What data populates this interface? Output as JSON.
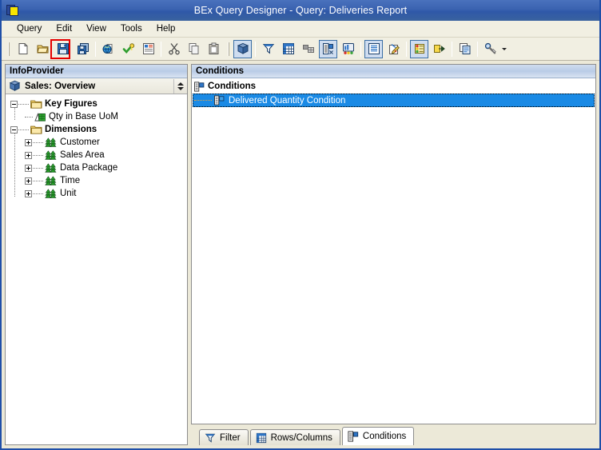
{
  "window": {
    "title": "BEx Query Designer - Query: Deliveries Report",
    "app_icon": "bex-app-icon"
  },
  "menubar": {
    "items": [
      {
        "label": "Query",
        "name": "menu-query"
      },
      {
        "label": "Edit",
        "name": "menu-edit"
      },
      {
        "label": "View",
        "name": "menu-view"
      },
      {
        "label": "Tools",
        "name": "menu-tools"
      },
      {
        "label": "Help",
        "name": "menu-help"
      }
    ]
  },
  "toolbar": {
    "buttons": [
      {
        "name": "new-query-button",
        "icon": "new-document-icon",
        "tooltip": "New Query",
        "active": false
      },
      {
        "name": "open-query-button",
        "icon": "open-folder-icon",
        "tooltip": "Open Query",
        "active": false
      },
      {
        "name": "save-query-button",
        "icon": "save-floppy-icon",
        "tooltip": "Save Query",
        "active": false,
        "highlighted": true
      },
      {
        "name": "save-as-button",
        "icon": "save-as-icon",
        "tooltip": "Save Query As",
        "active": false
      },
      {
        "name": "publish-button",
        "icon": "globe-icon",
        "tooltip": "Publish",
        "active": false
      },
      {
        "name": "check-query-button",
        "icon": "check-key-icon",
        "tooltip": "Check Query",
        "active": false
      },
      {
        "name": "query-properties-button",
        "icon": "query-properties-icon",
        "tooltip": "Query Properties",
        "active": false
      },
      {
        "name": "cut-button",
        "icon": "scissors-icon",
        "tooltip": "Cut",
        "active": false
      },
      {
        "name": "copy-button",
        "icon": "copy-icon",
        "tooltip": "Copy",
        "active": false
      },
      {
        "name": "paste-button",
        "icon": "paste-icon",
        "tooltip": "Paste",
        "active": false
      },
      {
        "name": "infoprovider-button",
        "icon": "cube-icon",
        "tooltip": "InfoProvider",
        "active": true
      },
      {
        "name": "filter-toggle-button",
        "icon": "funnel-icon",
        "tooltip": "Filter",
        "active": false
      },
      {
        "name": "rows-columns-button",
        "icon": "grid-icon",
        "tooltip": "Rows/Columns",
        "active": false
      },
      {
        "name": "cell-definition-button",
        "icon": "cells-icon",
        "tooltip": "Cells",
        "active": false
      },
      {
        "name": "conditions-toggle-button",
        "icon": "conditions-icon",
        "tooltip": "Conditions",
        "active": true
      },
      {
        "name": "chart-preview-button",
        "icon": "chart-monitor-icon",
        "tooltip": "Chart",
        "active": false
      },
      {
        "name": "exceptions-list-button",
        "icon": "exceptions-list-icon",
        "tooltip": "Exceptions",
        "active": true
      },
      {
        "name": "document-properties-button",
        "icon": "doc-pencil-icon",
        "tooltip": "Documents",
        "active": false
      },
      {
        "name": "condition-define-button",
        "icon": "condition-stack-icon",
        "tooltip": "Define Condition",
        "active": true
      },
      {
        "name": "jump-target-button",
        "icon": "jump-arrow-icon",
        "tooltip": "Jump Targets",
        "active": false
      },
      {
        "name": "variables-button",
        "icon": "variables-icon",
        "tooltip": "Variables",
        "active": false
      },
      {
        "name": "settings-button",
        "icon": "wrench-icon",
        "tooltip": "Settings",
        "active": false
      }
    ]
  },
  "infoprovider": {
    "panel_title": "InfoProvider",
    "provider_name": "Sales: Overview",
    "provider_icon": "cube-icon",
    "spinner_name": "provider-spinner",
    "tree": [
      {
        "label": "Key Figures",
        "icon": "folder-icon",
        "bold": true,
        "expander": "minus",
        "name": "tree-node-key-figures",
        "children": [
          {
            "label": "Qty in Base UoM",
            "icon": "key-figure-icon",
            "bold": false,
            "name": "tree-node-qty-in-base-uom"
          }
        ]
      },
      {
        "label": "Dimensions",
        "icon": "folder-icon",
        "bold": true,
        "expander": "minus",
        "name": "tree-node-dimensions",
        "children": [
          {
            "label": "Customer",
            "icon": "dimension-icon",
            "bold": false,
            "expander": "plus",
            "name": "tree-node-customer"
          },
          {
            "label": "Sales Area",
            "icon": "dimension-icon",
            "bold": false,
            "expander": "plus",
            "name": "tree-node-sales-area"
          },
          {
            "label": "Data Package",
            "icon": "dimension-icon",
            "bold": false,
            "expander": "plus",
            "name": "tree-node-data-package"
          },
          {
            "label": "Time",
            "icon": "dimension-icon",
            "bold": false,
            "expander": "plus",
            "name": "tree-node-time"
          },
          {
            "label": "Unit",
            "icon": "dimension-icon",
            "bold": false,
            "expander": "plus",
            "name": "tree-node-unit"
          }
        ]
      }
    ]
  },
  "conditions": {
    "panel_title": "Conditions",
    "root_label": "Conditions",
    "root_icon": "conditions-icon",
    "items": [
      {
        "label": "Delivered Quantity Condition",
        "icon": "condition-item-icon",
        "selected": true,
        "name": "conditions-list-item"
      }
    ]
  },
  "tabs": [
    {
      "label": "Filter",
      "icon": "funnel-icon",
      "selected": false,
      "name": "tab-filter"
    },
    {
      "label": "Rows/Columns",
      "icon": "grid-icon",
      "selected": false,
      "name": "tab-rows-columns"
    },
    {
      "label": "Conditions",
      "icon": "conditions-icon",
      "selected": true,
      "name": "tab-conditions"
    }
  ],
  "colors": {
    "titlebar_blue": "#3a62b0",
    "selection_blue": "#1a8ae5",
    "annotation_red": "#e60000",
    "panel_header_blue": "#b9cce6",
    "window_bg": "#ece9d8",
    "toolbar_active_border": "#3a6ea5"
  }
}
